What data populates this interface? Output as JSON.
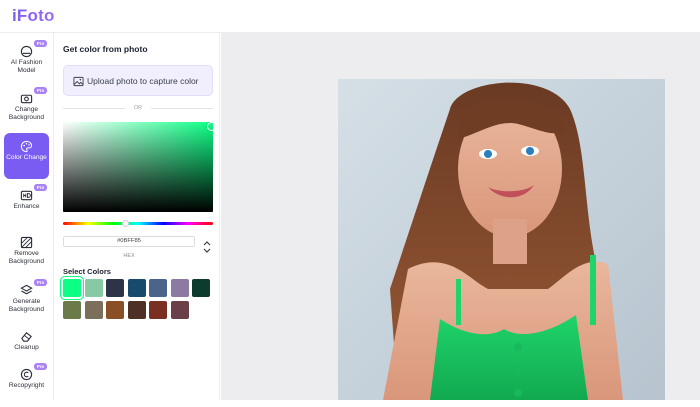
{
  "app": {
    "logo": "iFoto"
  },
  "sidebar": {
    "items": [
      {
        "label": "AI Fashion Model",
        "icon": "face-icon",
        "pro": true,
        "active": false
      },
      {
        "label": "Change Background",
        "icon": "camera-icon",
        "pro": true,
        "active": false
      },
      {
        "label": "Color Change",
        "icon": "palette-icon",
        "pro": false,
        "active": true
      },
      {
        "label": "Enhance",
        "icon": "hd-icon",
        "pro": true,
        "active": false
      },
      {
        "label": "Remove Background",
        "icon": "remove-bg-icon",
        "pro": false,
        "active": false
      },
      {
        "label": "Generate Background",
        "icon": "layers-icon",
        "pro": true,
        "active": false
      },
      {
        "label": "Cleanup",
        "icon": "eraser-icon",
        "pro": false,
        "active": false
      },
      {
        "label": "Recopyright",
        "icon": "copyright-icon",
        "pro": true,
        "active": false
      }
    ],
    "pro_badge": "Pro"
  },
  "panel": {
    "title": "Get color from photo",
    "upload_label": "Upload photo to capture color",
    "or_label": "OR",
    "hex_value": "#0BFF85",
    "hex_label": "HEX",
    "select_title": "Select Colors",
    "swatches": [
      "#0bff85",
      "#86c9a3",
      "#2e3448",
      "#184a6b",
      "#4b6489",
      "#8d7aa0",
      "#0d3b2e",
      "#6b7a49",
      "#7b6f5b",
      "#8a4f25",
      "#4f3024",
      "#7a2f22",
      "#6a3f48"
    ]
  },
  "colors": {
    "accent": "#7a5cf2",
    "selected": "#0bff85"
  }
}
